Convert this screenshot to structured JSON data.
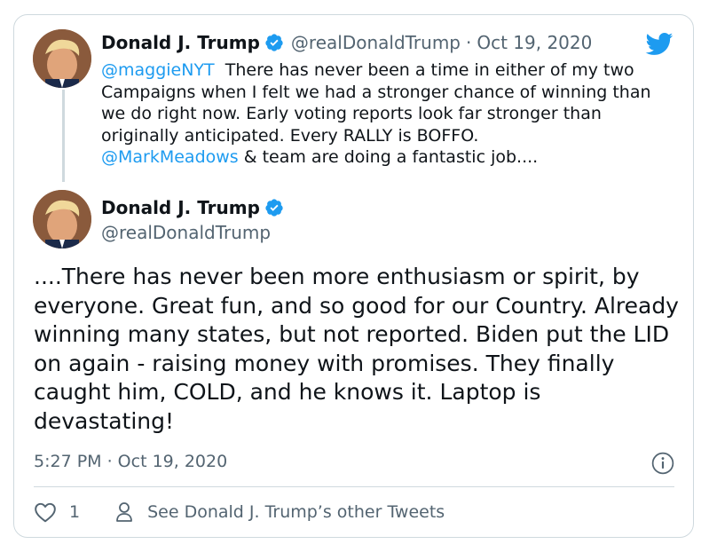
{
  "colors": {
    "accent": "#1d9bf0",
    "text": "#0f1419",
    "secondary": "#536471",
    "border": "#cfd9de"
  },
  "icons": [
    "twitter-bird-icon",
    "verified-badge-icon",
    "info-icon",
    "heart-icon",
    "person-icon"
  ],
  "reply_tweet": {
    "name": "Donald J. Trump",
    "handle": "@realDonaldTrump",
    "separator": "·",
    "date": "Oct 19, 2020",
    "mention_1": "@maggieNYT",
    "text_1": "  There has never been a time in either of my two Campaigns when I felt we had a stronger chance of winning than we do right now. Early voting reports look far stronger than originally anticipated. Every RALLY is BOFFO.",
    "mention_2": "@MarkMeadows",
    "text_2": " & team are doing a fantastic job...."
  },
  "main_tweet": {
    "name": "Donald J. Trump",
    "handle": "@realDonaldTrump",
    "text": "....There has never been more enthusiasm or spirit, by everyone. Great fun, and so good for our Country. Already winning many states, but not reported. Biden put the LID on again - raising money with promises. They finally caught him, COLD, and he knows it. Laptop is devastating!",
    "timestamp": "5:27 PM · Oct 19, 2020",
    "like_count": "1",
    "other_tweets_label": "See Donald J. Trump’s other Tweets"
  }
}
